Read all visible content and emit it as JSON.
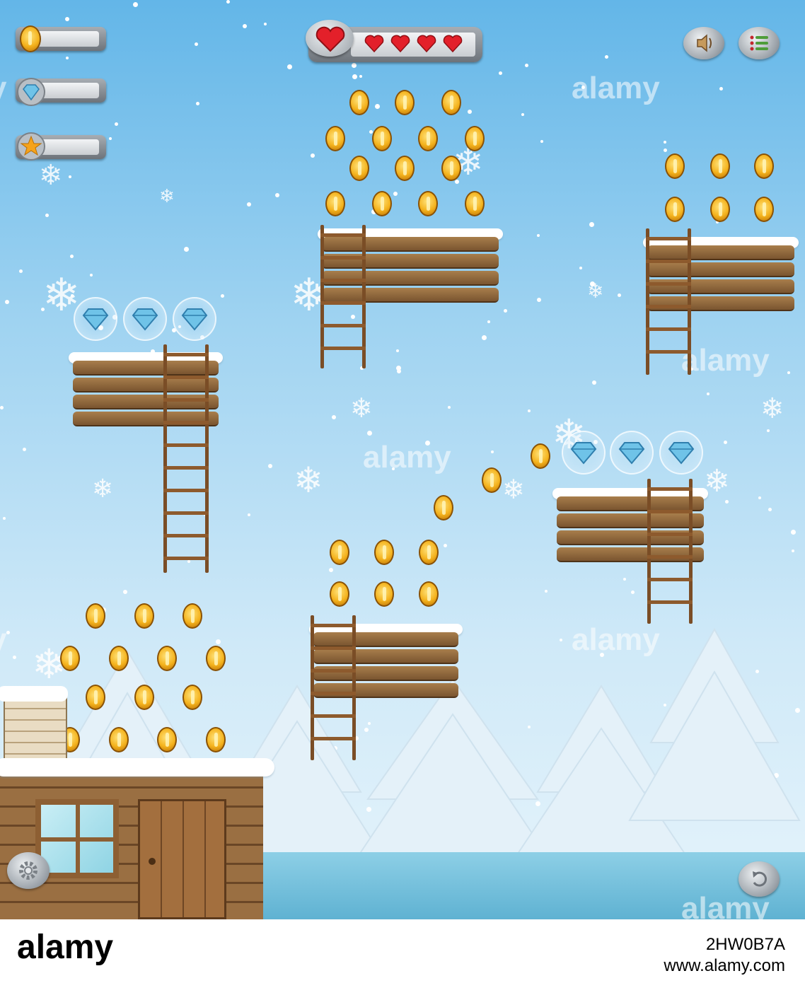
{
  "hud": {
    "coin_counter": {
      "icon": "coin-icon",
      "value": ""
    },
    "gem_counter": {
      "icon": "diamond-icon",
      "value": ""
    },
    "star_counter": {
      "icon": "star-icon",
      "value": ""
    },
    "lives": {
      "icon": "heart-icon",
      "hearts": 4
    },
    "buttons": [
      "sound-icon",
      "menu-icon",
      "settings-gear-icon",
      "restart-icon"
    ]
  },
  "colors": {
    "sky_top": "#63b6e8",
    "sky_bottom": "#e6f4fb",
    "wood": "#8a6037",
    "water": "#7ec7e1",
    "coin": "#f4b21c",
    "heart": "#e3202a",
    "gem": "#6fc3e8"
  },
  "watermarks": [
    "alamy",
    "alamy",
    "alamy",
    "alamy",
    "alamy",
    "alamy",
    "alamy",
    "alamy"
  ],
  "footer": {
    "brand": "alamy",
    "image_id": "2HW0B7A",
    "url": "www.alamy.com"
  }
}
